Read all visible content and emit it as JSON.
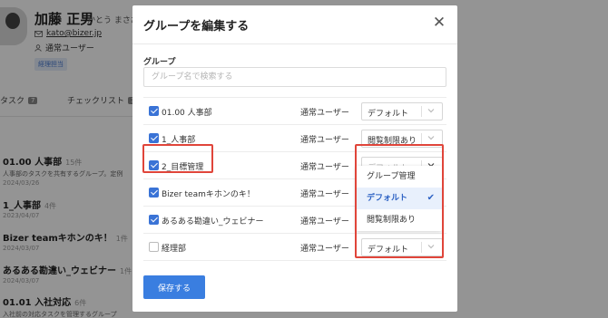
{
  "user": {
    "name": "加藤 正男",
    "kana": "かとう まさお",
    "email": "kato@bizer.jp",
    "role": "通常ユーザー",
    "tag": "経理担当"
  },
  "tabs": [
    {
      "label": "タスク",
      "count": "7"
    },
    {
      "label": "チェックリスト",
      "count": "3"
    }
  ],
  "groups": [
    {
      "title": "01.00 人事部",
      "count": "15件",
      "desc": "人事部のタスクを共有するグループ。定例",
      "date": "2024/03/26"
    },
    {
      "title": "1_人事部",
      "count": "4件",
      "desc": "",
      "date": "2023/04/07"
    },
    {
      "title": "Bizer teamキホンのキ！",
      "count": "1件",
      "desc": "",
      "date": "2024/03/07"
    },
    {
      "title": "あるある勘違い_ウェビナー",
      "count": "1件",
      "desc": "",
      "date": "2024/03/07"
    },
    {
      "title": "01.01 入社対応",
      "count": "6件",
      "desc": "入社前の対応タスクを管理するグループ",
      "date": ""
    }
  ],
  "modal": {
    "title": "グループを編集する",
    "close": "✕",
    "section_label": "グループ",
    "search_placeholder": "グループ名で検索する",
    "rows": [
      {
        "name": "01.00 人事部",
        "checked": true,
        "role": "通常ユーザー",
        "permission": "デフォルト"
      },
      {
        "name": "1_人事部",
        "checked": true,
        "role": "通常ユーザー",
        "permission": "閲覧制限あり"
      },
      {
        "name": "2_目標管理",
        "checked": true,
        "role": "通常ユーザー",
        "permission": "デフォルト"
      },
      {
        "name": "Bizer teamキホンのキ！",
        "checked": true,
        "role": "通常ユーザー",
        "permission": ""
      },
      {
        "name": "あるある勘違い_ウェビナー",
        "checked": true,
        "role": "通常ユーザー",
        "permission": ""
      },
      {
        "name": "経理部",
        "checked": false,
        "role": "通常ユーザー",
        "permission": "デフォルト"
      }
    ],
    "dropdown_options": [
      "グループ管理",
      "デフォルト",
      "閲覧制限あり"
    ],
    "dropdown_selected": "デフォルト",
    "save_label": "保存する"
  },
  "colors": {
    "accent": "#3a7ee0",
    "highlight": "#e0453a",
    "overlay": "rgba(0,0,0,0.42)"
  }
}
